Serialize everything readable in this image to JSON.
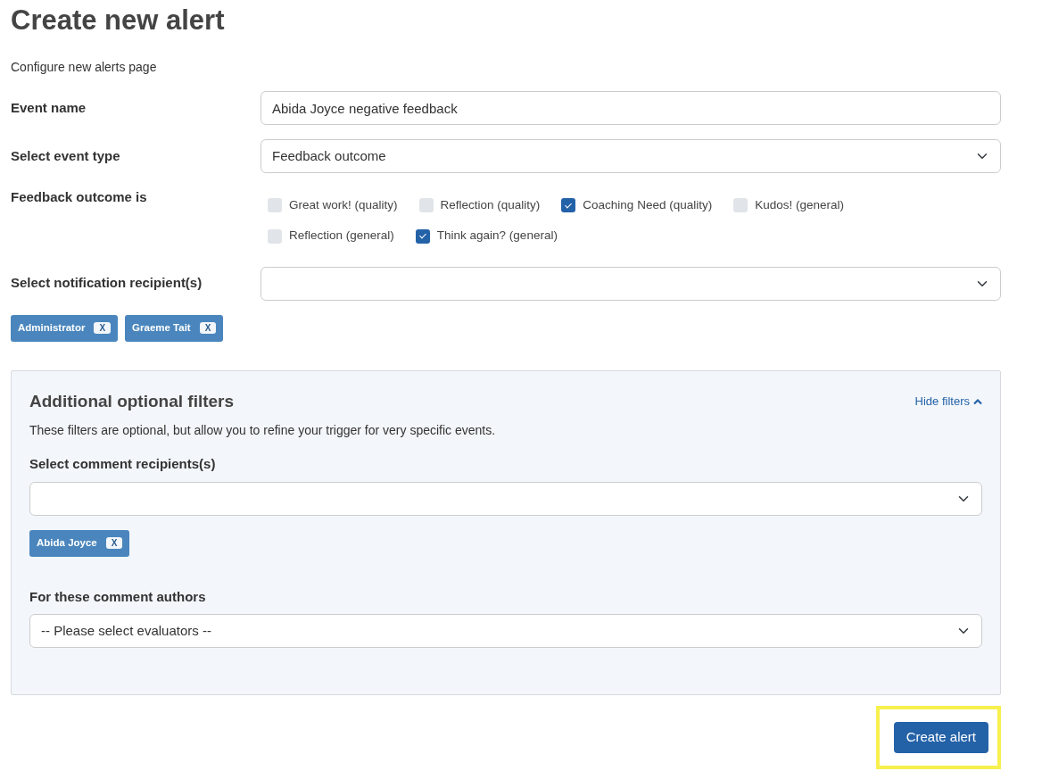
{
  "title": "Create new alert",
  "subtitle": "Configure new alerts page",
  "event_name": {
    "label": "Event name",
    "value": "Abida Joyce negative feedback"
  },
  "event_type": {
    "label": "Select event type",
    "value": "Feedback outcome"
  },
  "feedback_outcome": {
    "label": "Feedback outcome is",
    "options": [
      {
        "label": "Great work! (quality)",
        "checked": false
      },
      {
        "label": "Reflection (quality)",
        "checked": false
      },
      {
        "label": "Coaching Need (quality)",
        "checked": true
      },
      {
        "label": "Kudos! (general)",
        "checked": false
      },
      {
        "label": "Reflection (general)",
        "checked": false
      },
      {
        "label": "Think again? (general)",
        "checked": true
      }
    ]
  },
  "notification_recipients": {
    "label": "Select notification recipient(s)",
    "tags": [
      {
        "label": "Administrator",
        "remove": "X"
      },
      {
        "label": "Graeme Tait",
        "remove": "X"
      }
    ]
  },
  "filters": {
    "title": "Additional optional filters",
    "toggle": "Hide filters",
    "expanded": true,
    "description": "These filters are optional, but allow you to refine your trigger for very specific events.",
    "comment_recipients": {
      "label": "Select comment recipients(s)",
      "tags": [
        {
          "label": "Abida Joyce",
          "remove": "X"
        }
      ]
    },
    "comment_authors": {
      "label": "For these comment authors",
      "value": "-- Please select evaluators --"
    }
  },
  "submit": {
    "label": "Create alert",
    "highlighted": true
  }
}
